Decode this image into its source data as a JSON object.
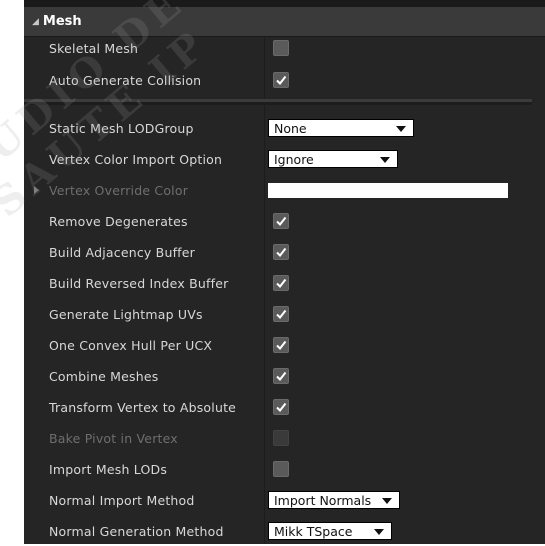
{
  "section": {
    "title": "Mesh"
  },
  "rows": [
    {
      "label": "Skeletal Mesh",
      "control": "checkbox",
      "checked": false
    },
    {
      "label": "Auto Generate Collision",
      "control": "checkbox",
      "checked": true
    },
    {
      "label": "Static Mesh LODGroup",
      "control": "dropdown",
      "value": "None"
    },
    {
      "label": "Vertex Color Import Option",
      "control": "dropdown",
      "value": "Ignore"
    },
    {
      "label": "Vertex Override Color",
      "control": "color",
      "value": "#FFFFFF"
    },
    {
      "label": "Remove Degenerates",
      "control": "checkbox",
      "checked": true
    },
    {
      "label": "Build Adjacency Buffer",
      "control": "checkbox",
      "checked": true
    },
    {
      "label": "Build Reversed Index Buffer",
      "control": "checkbox",
      "checked": true
    },
    {
      "label": "Generate Lightmap UVs",
      "control": "checkbox",
      "checked": true
    },
    {
      "label": "One Convex Hull Per UCX",
      "control": "checkbox",
      "checked": true
    },
    {
      "label": "Combine Meshes",
      "control": "checkbox",
      "checked": true
    },
    {
      "label": "Transform Vertex to Absolute",
      "control": "checkbox",
      "checked": true
    },
    {
      "label": "Bake Pivot in Vertex",
      "control": "checkbox",
      "checked": false
    },
    {
      "label": "Import Mesh LODs",
      "control": "checkbox",
      "checked": false
    },
    {
      "label": "Normal Import Method",
      "control": "dropdown",
      "value": "Import Normals"
    },
    {
      "label": "Normal Generation Method",
      "control": "dropdown",
      "value": "Mikk TSpace"
    }
  ],
  "watermark": [
    "STUDIO DE",
    "SAUTE IP"
  ]
}
